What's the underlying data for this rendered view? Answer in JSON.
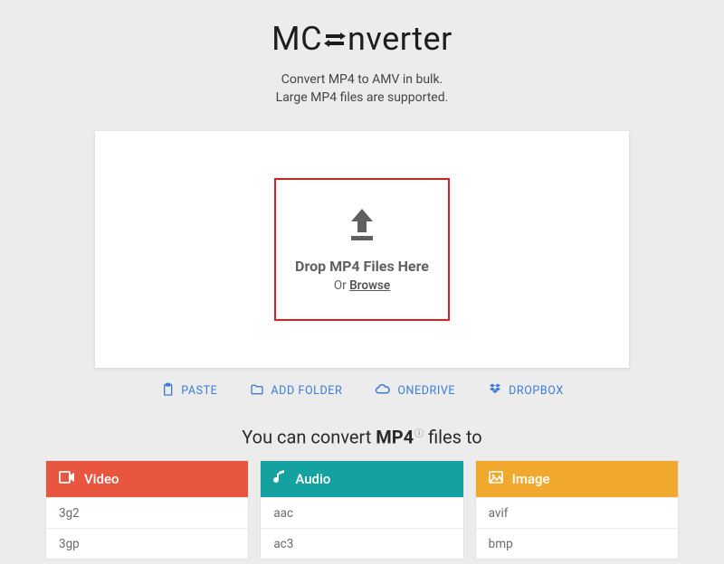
{
  "logo": {
    "left": "MC",
    "right": "nverter"
  },
  "subtitle": {
    "line1": "Convert MP4 to AMV in bulk.",
    "line2": "Large MP4 files are supported."
  },
  "drop": {
    "title": "Drop MP4 Files Here",
    "or": "Or ",
    "browse": "Browse"
  },
  "actions": {
    "paste": "PASTE",
    "add_folder": "ADD FOLDER",
    "onedrive": "ONEDRIVE",
    "dropbox": "DROPBOX"
  },
  "convert_heading": {
    "prefix": "You can convert ",
    "format": "MP4",
    "suffix": " files to"
  },
  "categories": {
    "video": {
      "label": "Video",
      "items": [
        "3g2",
        "3gp"
      ]
    },
    "audio": {
      "label": "Audio",
      "items": [
        "aac",
        "ac3"
      ]
    },
    "image": {
      "label": "Image",
      "items": [
        "avif",
        "bmp"
      ]
    }
  },
  "colors": {
    "accent_blue": "#3b7bd8",
    "video": "#e9563f",
    "audio": "#14a2a0",
    "image": "#f0a92d",
    "highlight_border": "#e21a1a"
  }
}
